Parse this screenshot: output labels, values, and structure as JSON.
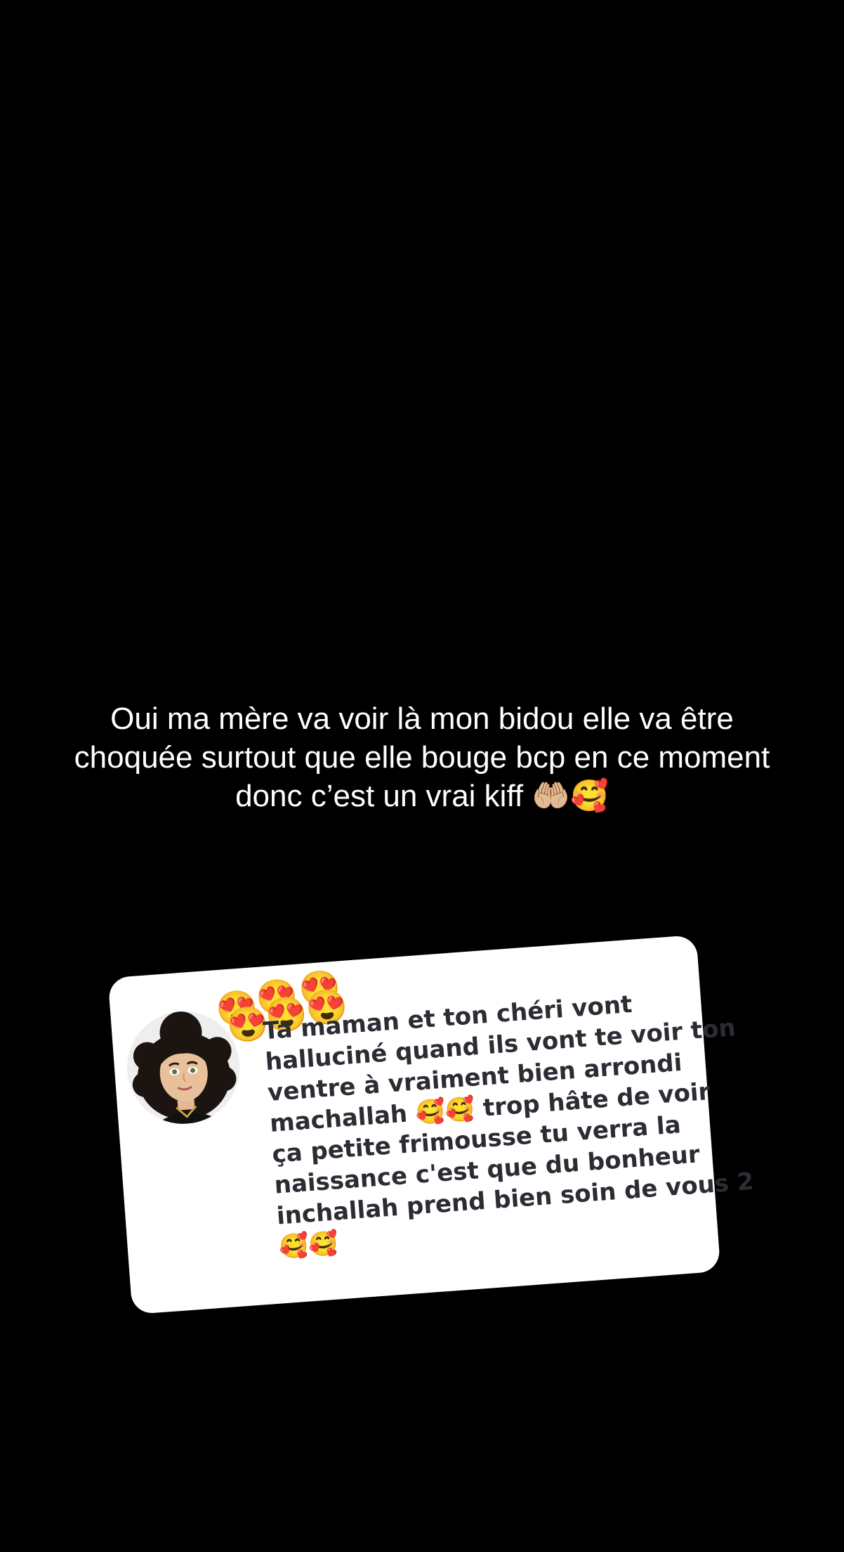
{
  "story": {
    "background": "#000000",
    "caption": {
      "lines": [
        "Oui ma mère va voir là mon bidou elle va être",
        "choquée surtout que elle bouge bcp en ce moment",
        "donc c’est un vrai kiff 🤲🏼🥰"
      ],
      "color": "#ffffff"
    }
  },
  "reply_card": {
    "background": "#ffffff",
    "avatar_icon": "bitmoji-avatar-icon",
    "emoji_cluster": [
      "😍",
      "😍",
      "😍",
      "😍",
      "😍",
      "😍"
    ],
    "text_color": "#2c2c34",
    "lines": [
      "Ta maman et ton chéri vont",
      "halluciné quand ils vont te voir ton",
      "ventre à vraiment bien arrondi",
      "machallah 🥰🥰 trop hâte de voir",
      "ça petite frimousse tu verra la",
      "naissance c'est que du bonheur",
      "inchallah prend bien soin de vous 2",
      "🥰🥰"
    ]
  }
}
